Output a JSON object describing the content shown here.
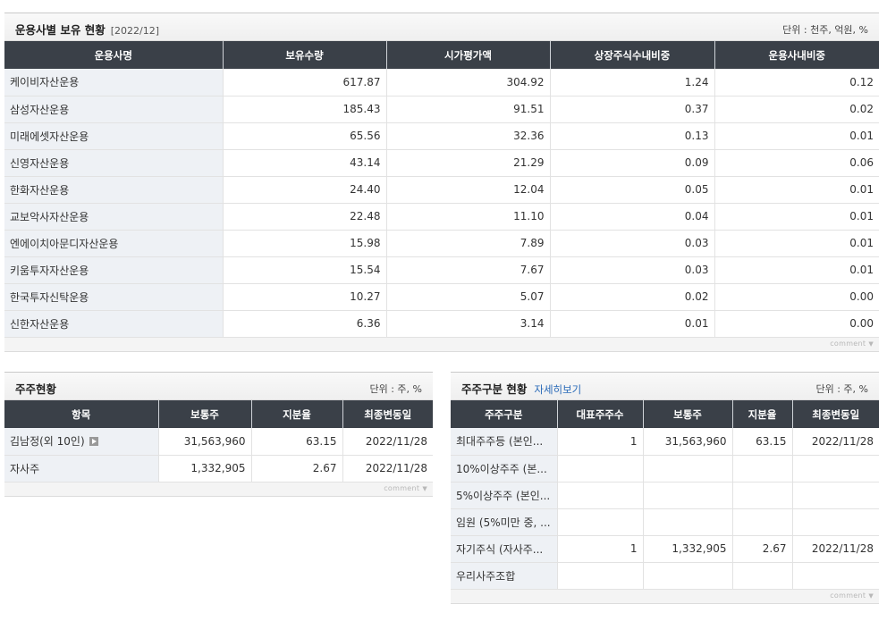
{
  "top": {
    "title": "운용사별 보유 현황",
    "date": "[2022/12]",
    "unit": "단위 : 천주, 억원, %",
    "headers": [
      "운용사명",
      "보유수량",
      "시가평가액",
      "상장주식수내비중",
      "운용사내비중"
    ],
    "rows": [
      [
        "케이비자산운용",
        "617.87",
        "304.92",
        "1.24",
        "0.12"
      ],
      [
        "삼성자산운용",
        "185.43",
        "91.51",
        "0.37",
        "0.02"
      ],
      [
        "미래에셋자산운용",
        "65.56",
        "32.36",
        "0.13",
        "0.01"
      ],
      [
        "신영자산운용",
        "43.14",
        "21.29",
        "0.09",
        "0.06"
      ],
      [
        "한화자산운용",
        "24.40",
        "12.04",
        "0.05",
        "0.01"
      ],
      [
        "교보악사자산운용",
        "22.48",
        "11.10",
        "0.04",
        "0.01"
      ],
      [
        "엔에이치아문디자산운용",
        "15.98",
        "7.89",
        "0.03",
        "0.01"
      ],
      [
        "키움투자자산운용",
        "15.54",
        "7.67",
        "0.03",
        "0.01"
      ],
      [
        "한국투자신탁운용",
        "10.27",
        "5.07",
        "0.02",
        "0.00"
      ],
      [
        "신한자산운용",
        "6.36",
        "3.14",
        "0.01",
        "0.00"
      ]
    ],
    "comment": "comment"
  },
  "left": {
    "title": "주주현황",
    "unit": "단위 : 주, %",
    "headers": [
      "항목",
      "보통주",
      "지분율",
      "최종변동일"
    ],
    "rows": [
      [
        "김남정(외 10인)",
        "31,563,960",
        "63.15",
        "2022/11/28"
      ],
      [
        "자사주",
        "1,332,905",
        "2.67",
        "2022/11/28"
      ]
    ],
    "comment": "comment"
  },
  "right": {
    "title": "주주구분 현황",
    "link": "자세히보기",
    "unit": "단위 : 주, %",
    "headers": [
      "주주구분",
      "대표주주수",
      "보통주",
      "지분율",
      "최종변동일"
    ],
    "rows": [
      [
        "최대주주등 (본인...",
        "1",
        "31,563,960",
        "63.15",
        "2022/11/28"
      ],
      [
        "10%이상주주 (본...",
        "",
        "",
        "",
        ""
      ],
      [
        "5%이상주주 (본인...",
        "",
        "",
        "",
        ""
      ],
      [
        "임원 (5%미만 중, ...",
        "",
        "",
        "",
        ""
      ],
      [
        "자기주식 (자사주...",
        "1",
        "1,332,905",
        "2.67",
        "2022/11/28"
      ],
      [
        "우리사주조합",
        "",
        "",
        "",
        ""
      ]
    ],
    "comment": "comment"
  }
}
